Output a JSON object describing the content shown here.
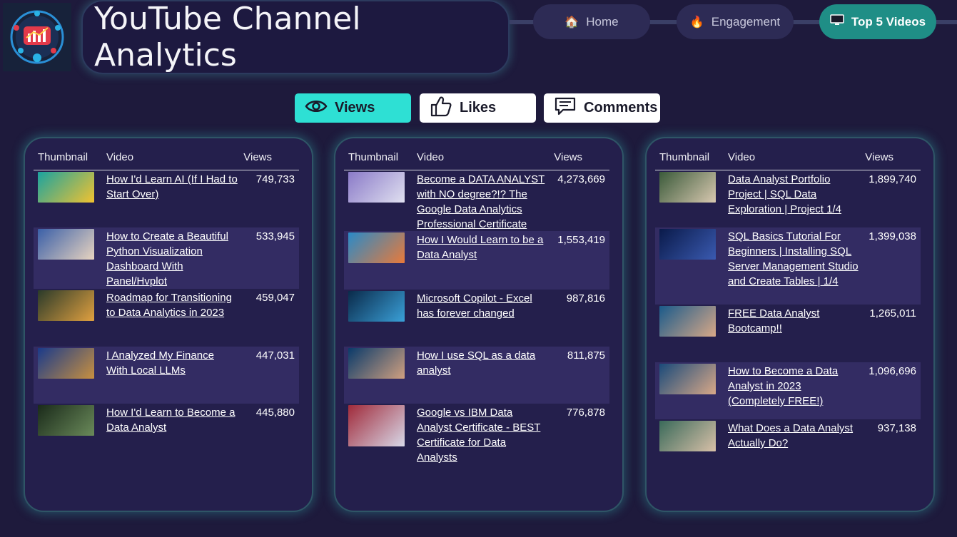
{
  "header": {
    "title": "YouTube Channel Analytics",
    "logo_icon": "analytics-logo-icon"
  },
  "nav": [
    {
      "label": "Home",
      "icon": "home-icon",
      "active": false
    },
    {
      "label": "Engagement",
      "icon": "fire-icon",
      "active": false
    },
    {
      "label": "Top 5 Videos",
      "icon": "monitor-icon",
      "active": true
    }
  ],
  "metrics": [
    {
      "label": "Views",
      "icon": "eye-icon",
      "active": true
    },
    {
      "label": "Likes",
      "icon": "thumbs-up-icon",
      "active": false
    },
    {
      "label": "Comments",
      "icon": "comment-icon",
      "active": false
    }
  ],
  "table_headers": {
    "thumbnail": "Thumbnail",
    "video": "Video",
    "views": "Views"
  },
  "panels": [
    {
      "rows": [
        {
          "title": "How I'd Learn AI (If I Had to Start Over)",
          "views": "749,733"
        },
        {
          "title": "How to Create a Beautiful Python Visualization Dashboard With Panel/Hvplot",
          "views": "533,945"
        },
        {
          "title": "Roadmap for Transitioning to Data Analytics in 2023",
          "views": "459,047"
        },
        {
          "title": "I Analyzed My Finance With Local LLMs",
          "views": "447,031"
        },
        {
          "title": "How I'd Learn to Become a Data Analyst",
          "views": "445,880"
        }
      ]
    },
    {
      "rows": [
        {
          "title": "Become a DATA ANALYST with NO degree?!? The Google Data Analytics Professional Certificate",
          "views": "4,273,669"
        },
        {
          "title": "How I Would Learn to be a Data Analyst",
          "views": "1,553,419"
        },
        {
          "title": "Microsoft Copilot - Excel has forever changed",
          "views": "987,816"
        },
        {
          "title": "How I use SQL as a data analyst",
          "views": "811,875"
        },
        {
          "title": "Google vs IBM Data Analyst Certificate - BEST Certificate for Data Analysts",
          "views": "776,878"
        }
      ]
    },
    {
      "rows": [
        {
          "title": "Data Analyst Portfolio Project | SQL Data Exploration | Project 1/4",
          "views": "1,899,740"
        },
        {
          "title": "SQL Basics Tutorial For Beginners | Installing SQL Server Management Studio and Create Tables | 1/4",
          "views": "1,399,038"
        },
        {
          "title": "FREE Data Analyst Bootcamp!!",
          "views": "1,265,011"
        },
        {
          "title": "How to Become a Data Analyst in 2023 (Completely FREE!)",
          "views": "1,096,696"
        },
        {
          "title": "What Does a Data Analyst Actually Do?",
          "views": "937,138"
        }
      ]
    }
  ]
}
